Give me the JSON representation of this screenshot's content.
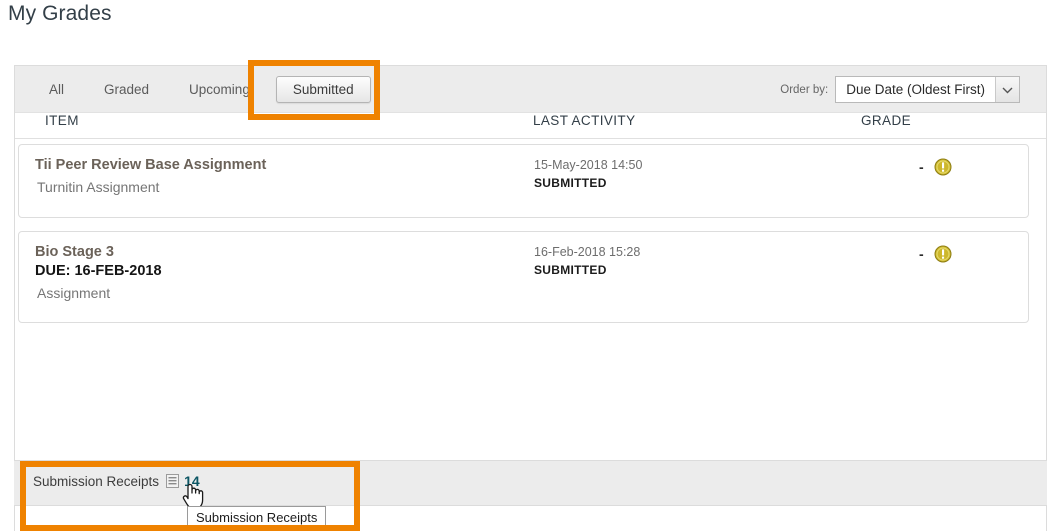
{
  "page": {
    "title": "My Grades"
  },
  "filter_bar": {
    "tabs": [
      {
        "label": "All",
        "active": false
      },
      {
        "label": "Graded",
        "active": false
      },
      {
        "label": "Upcoming",
        "active": false
      },
      {
        "label": "Submitted",
        "active": true
      }
    ],
    "order_by": {
      "label": "Order by:",
      "selected": "Due Date (Oldest First)",
      "icon": "chevron-down-icon"
    }
  },
  "columns": {
    "item": "ITEM",
    "last_activity": "LAST ACTIVITY",
    "grade": "GRADE"
  },
  "rows": [
    {
      "title": "Tii Peer Review Base Assignment",
      "due": "",
      "type": "Turnitin Assignment",
      "activity_date": "15-May-2018 14:50",
      "status": "SUBMITTED",
      "grade": "-",
      "grade_icon": "exclamation-circle-icon"
    },
    {
      "title": "Bio Stage 3",
      "due": "DUE: 16-FEB-2018",
      "type": "Assignment",
      "activity_date": "16-Feb-2018 15:28",
      "status": "SUBMITTED",
      "grade": "-",
      "grade_icon": "exclamation-circle-icon"
    }
  ],
  "receipts": {
    "label": "Submission Receipts",
    "icon": "receipt-document-icon",
    "count": "14"
  },
  "tooltip": {
    "text": "Submission Receipts"
  },
  "colors": {
    "annotation": "#ef8200",
    "count_text": "#0b5563",
    "warning_icon": "#c8b020",
    "item_title": "#6b6259"
  }
}
